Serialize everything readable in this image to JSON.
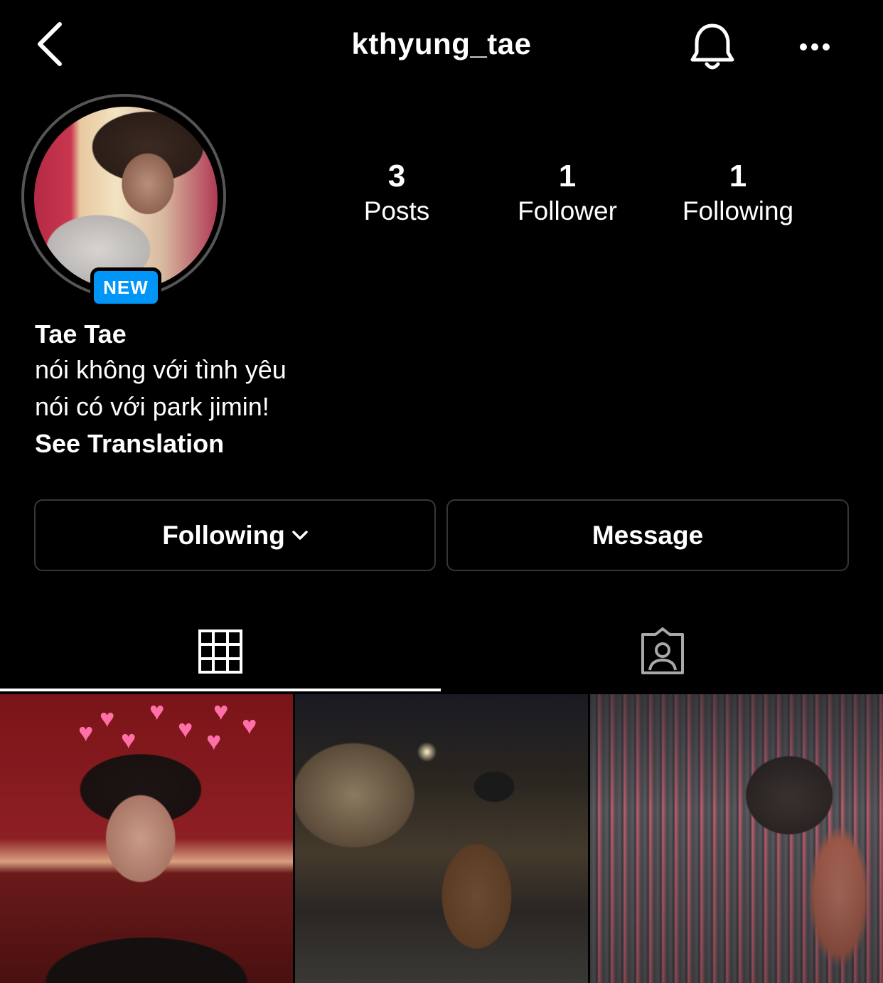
{
  "header": {
    "username": "kthyung_tae",
    "back_icon": "chevron-left-icon",
    "bell_icon": "bell-icon",
    "more_icon": "ellipsis-icon"
  },
  "profile": {
    "new_badge": "NEW",
    "avatar_icon": "profile-photo"
  },
  "stats": {
    "posts": {
      "count": "3",
      "label": "Posts"
    },
    "followers": {
      "count": "1",
      "label": "Follower"
    },
    "following": {
      "count": "1",
      "label": "Following"
    }
  },
  "bio": {
    "name": "Tae Tae",
    "lines": [
      "nói không với tình yêu",
      "nói có với park jimin!"
    ],
    "see_translation": "See Translation"
  },
  "actions": {
    "following_label": "Following",
    "message_label": "Message"
  },
  "tabs": {
    "grid_icon": "grid-icon",
    "tagged_icon": "tagged-person-icon",
    "active": "grid"
  },
  "colors": {
    "background": "#000000",
    "accent": "#0095f6",
    "border": "#363636"
  }
}
